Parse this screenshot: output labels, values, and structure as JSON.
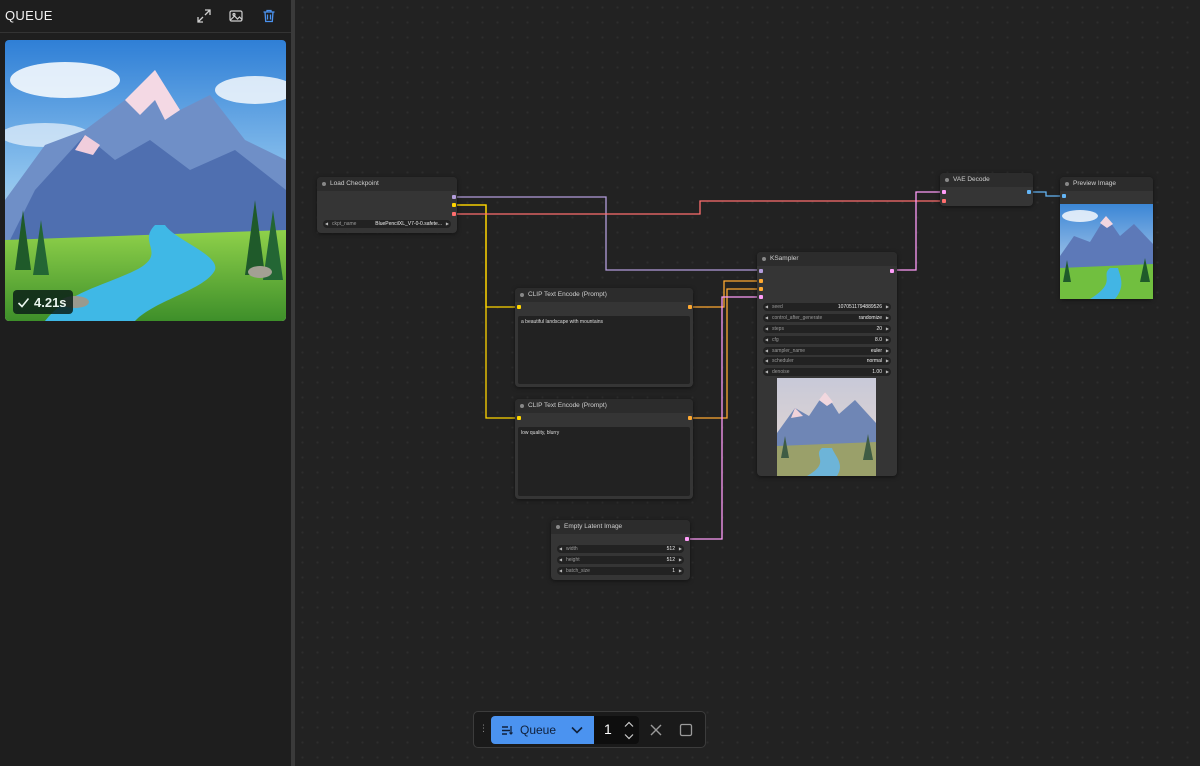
{
  "queue_panel": {
    "title": "QUEUE",
    "items": [
      {
        "duration": "4.21s",
        "status": "completed"
      }
    ],
    "icons": [
      "expand-icon",
      "image-icon",
      "trash-icon"
    ]
  },
  "nodes": {
    "load_checkpoint": {
      "title": "Load Checkpoint",
      "widgets": [
        {
          "name": "ckpt_name",
          "value": "BluePencilXL_V7-0-0.safete..."
        }
      ]
    },
    "clip_positive": {
      "title": "CLIP Text Encode (Prompt)",
      "text": "a beautiful landscape with mountains"
    },
    "clip_negative": {
      "title": "CLIP Text Encode (Prompt)",
      "text": "low quality, blurry"
    },
    "empty_latent": {
      "title": "Empty Latent Image",
      "widgets": [
        {
          "name": "width",
          "value": "512"
        },
        {
          "name": "height",
          "value": "512"
        },
        {
          "name": "batch_size",
          "value": "1"
        }
      ]
    },
    "ksampler": {
      "title": "KSampler",
      "widgets": [
        {
          "name": "seed",
          "value": "1070511794889526"
        },
        {
          "name": "control_after_generate",
          "value": "randomize"
        },
        {
          "name": "steps",
          "value": "20"
        },
        {
          "name": "cfg",
          "value": "8.0"
        },
        {
          "name": "sampler_name",
          "value": "euler"
        },
        {
          "name": "scheduler",
          "value": "normal"
        },
        {
          "name": "denoise",
          "value": "1.00"
        }
      ]
    },
    "vae_decode": {
      "title": "VAE Decode"
    },
    "preview_image": {
      "title": "Preview Image"
    }
  },
  "toolbar": {
    "queue_label": "Queue",
    "batch_count": "1",
    "icons": [
      "drag-handle-icon",
      "queue-list-icon",
      "chevron-down-icon",
      "chevron-up-icon",
      "close-icon",
      "stop-icon"
    ]
  },
  "colors": {
    "accent": "#4b93f0",
    "model_link": "#b39ddb",
    "clip_link": "#ffd500",
    "vae_link": "#ff6e6e",
    "latent_link": "#ff9cf9",
    "image_link": "#64b5f6",
    "success": "#6fdc8c"
  }
}
